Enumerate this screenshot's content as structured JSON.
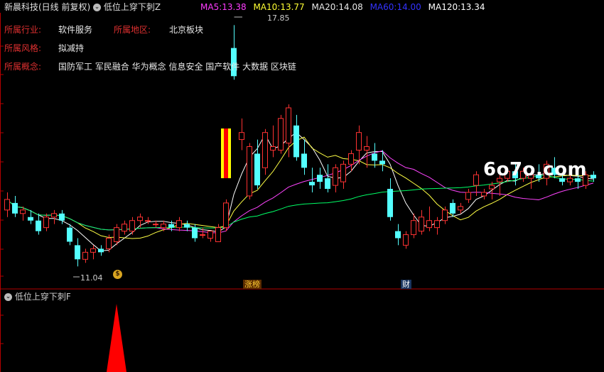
{
  "header": {
    "title": "新晨科技(日线 前复权)",
    "indicator_name": "低位上穿下刺Z",
    "ma": [
      {
        "label": "MA5:",
        "value": "13.38",
        "color": "#ff3cff"
      },
      {
        "label": "MA10:",
        "value": "13.77",
        "color": "#ffff33"
      },
      {
        "label": "MA20:",
        "value": "14.08",
        "color": "#e8e8e8"
      },
      {
        "label": "MA60:",
        "value": "14.00",
        "color": "#3333ff"
      },
      {
        "label": "MA120:",
        "value": "13.34",
        "color": "#ffffff"
      }
    ]
  },
  "info": {
    "industry_label": "所属行业:",
    "industry": "软件服务",
    "region_label": "所属地区:",
    "region": "北京板块",
    "style_label": "所属风格:",
    "style": "拟减持",
    "concept_label": "所属概念:",
    "concept": "国防军工 军民融合 华为概念 信息安全 国产软件 大数据 区块链"
  },
  "annotations": {
    "high": "17.85",
    "low": "11.04",
    "tag_limit": "涨榜",
    "tag_finance": "财"
  },
  "watermark": "6o7o.com",
  "sub_panel": {
    "title": "低位上穿下刺F"
  },
  "colors": {
    "up": "#ff3232",
    "down": "#54ffff",
    "ma5": "#ff44ff",
    "ma10": "#ffff44",
    "ma20": "#ffffff",
    "ma60": "#00ff66",
    "signal": "#ff0000",
    "axis": "#b40000"
  },
  "chart_data": {
    "type": "candlestick",
    "price_range": [
      10.5,
      18.2
    ],
    "candles": [
      [
        12.6,
        13.1,
        12.4,
        12.9
      ],
      [
        12.8,
        13.0,
        12.4,
        12.5
      ],
      [
        12.5,
        12.7,
        12.3,
        12.6
      ],
      [
        12.4,
        12.6,
        12.2,
        12.3
      ],
      [
        12.3,
        12.5,
        11.9,
        12.0
      ],
      [
        12.1,
        12.5,
        12.0,
        12.4
      ],
      [
        12.4,
        12.6,
        12.2,
        12.5
      ],
      [
        12.5,
        12.6,
        12.2,
        12.3
      ],
      [
        12.1,
        12.2,
        11.6,
        11.7
      ],
      [
        11.6,
        11.8,
        11.0,
        11.2
      ],
      [
        11.2,
        11.5,
        11.1,
        11.4
      ],
      [
        11.4,
        11.6,
        11.2,
        11.5
      ],
      [
        11.5,
        11.6,
        11.3,
        11.4
      ],
      [
        11.5,
        11.9,
        11.4,
        11.8
      ],
      [
        11.7,
        12.2,
        11.6,
        12.1
      ],
      [
        12.0,
        12.3,
        11.9,
        12.2
      ],
      [
        12.0,
        12.4,
        11.9,
        12.3
      ],
      [
        12.3,
        12.5,
        12.1,
        12.4
      ],
      [
        12.3,
        12.4,
        12.2,
        12.3
      ],
      [
        12.2,
        12.3,
        12.1,
        12.2
      ],
      [
        12.1,
        12.3,
        12.0,
        12.2
      ],
      [
        12.2,
        12.3,
        12.0,
        12.1
      ],
      [
        12.1,
        12.4,
        12.0,
        12.3
      ],
      [
        12.2,
        12.3,
        12.0,
        12.1
      ],
      [
        12.1,
        12.2,
        11.7,
        11.8
      ],
      [
        11.9,
        12.1,
        11.8,
        11.9
      ],
      [
        11.8,
        12.0,
        11.7,
        12.0
      ],
      [
        11.7,
        12.2,
        11.7,
        12.1
      ],
      [
        12.1,
        12.9,
        12.0,
        12.8
      ],
      [
        17.2,
        17.85,
        16.3,
        16.4
      ],
      [
        14.6,
        15.2,
        14.3,
        14.8
      ],
      [
        13.0,
        14.5,
        12.9,
        14.4
      ],
      [
        14.2,
        14.6,
        13.2,
        13.3
      ],
      [
        13.8,
        14.9,
        13.6,
        14.8
      ],
      [
        14.3,
        15.0,
        14.1,
        14.4
      ],
      [
        14.3,
        15.3,
        14.2,
        15.2
      ],
      [
        14.5,
        15.6,
        14.1,
        15.5
      ],
      [
        15.0,
        15.3,
        14.0,
        14.1
      ],
      [
        14.2,
        14.6,
        13.6,
        13.8
      ],
      [
        13.4,
        13.8,
        13.1,
        13.3
      ],
      [
        13.6,
        13.8,
        13.2,
        13.4
      ],
      [
        13.5,
        13.9,
        13.1,
        13.2
      ],
      [
        13.3,
        13.9,
        13.1,
        13.8
      ],
      [
        13.4,
        14.0,
        13.2,
        13.9
      ],
      [
        13.9,
        14.3,
        13.7,
        14.2
      ],
      [
        14.3,
        15.0,
        13.9,
        14.8
      ],
      [
        14.3,
        14.7,
        13.8,
        14.4
      ],
      [
        14.2,
        14.5,
        13.8,
        14.0
      ],
      [
        14.0,
        14.3,
        13.7,
        13.9
      ],
      [
        13.2,
        13.5,
        12.3,
        12.4
      ],
      [
        12.0,
        12.2,
        11.6,
        11.8
      ],
      [
        11.6,
        12.0,
        11.5,
        11.9
      ],
      [
        11.9,
        12.5,
        11.8,
        12.3
      ],
      [
        12.0,
        12.6,
        11.9,
        12.4
      ],
      [
        12.1,
        12.7,
        12.0,
        12.3
      ],
      [
        12.1,
        12.4,
        11.9,
        12.3
      ],
      [
        12.3,
        12.7,
        12.2,
        12.6
      ],
      [
        12.8,
        12.9,
        12.4,
        12.5
      ],
      [
        12.6,
        12.8,
        12.5,
        12.7
      ],
      [
        12.9,
        13.2,
        12.8,
        13.1
      ],
      [
        13.3,
        13.7,
        13.0,
        13.6
      ],
      [
        13.0,
        13.2,
        12.9,
        13.1
      ],
      [
        13.2,
        13.4,
        12.9,
        13.3
      ],
      [
        13.4,
        13.6,
        13.0,
        13.5
      ],
      [
        13.5,
        13.8,
        13.4,
        13.7
      ],
      [
        13.7,
        13.9,
        13.3,
        13.5
      ],
      [
        13.5,
        13.8,
        13.4,
        13.7
      ],
      [
        13.5,
        13.7,
        13.2,
        13.6
      ],
      [
        13.6,
        13.9,
        13.4,
        13.5
      ],
      [
        13.5,
        14.0,
        13.3,
        13.9
      ],
      [
        13.8,
        14.1,
        13.5,
        13.6
      ],
      [
        13.5,
        13.6,
        13.3,
        13.4
      ],
      [
        13.4,
        13.6,
        13.3,
        13.5
      ],
      [
        13.5,
        13.6,
        13.2,
        13.4
      ],
      [
        13.3,
        13.7,
        13.2,
        13.6
      ],
      [
        13.6,
        13.7,
        13.4,
        13.5
      ]
    ]
  }
}
